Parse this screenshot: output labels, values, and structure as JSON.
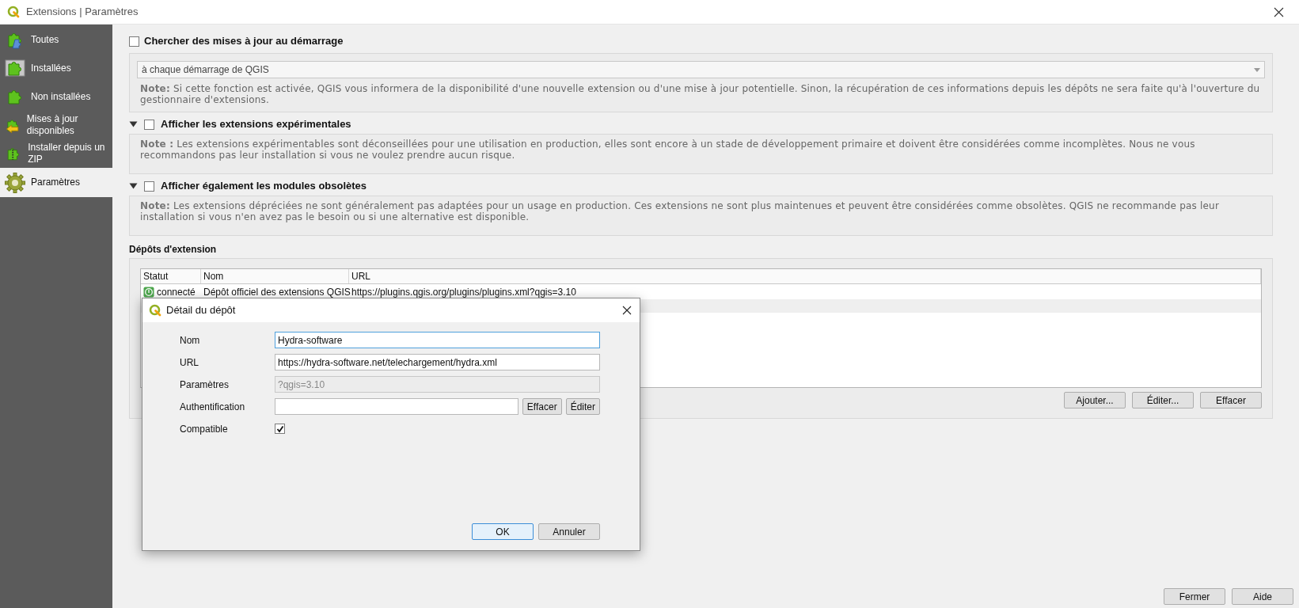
{
  "window": {
    "title": "Extensions | Paramètres"
  },
  "sidebar": {
    "items": [
      {
        "label": "Toutes",
        "selected": false
      },
      {
        "label": "Installées",
        "selected": false
      },
      {
        "label": "Non installées",
        "selected": false
      },
      {
        "label": "Mises à jour disponibles",
        "selected": false
      },
      {
        "label": "Installer depuis un ZIP",
        "selected": false
      },
      {
        "label": "Paramètres",
        "selected": true
      }
    ]
  },
  "check_updates": {
    "label": "Chercher des mises à jour au démarrage",
    "checked": false,
    "frequency": "à chaque démarrage de QGIS",
    "note": "**Note:** Si cette fonction est activée, QGIS vous informera de la disponibilité d'une nouvelle extension ou d'une mise à jour potentielle. Sinon, la récupération de ces informations depuis les dépôts ne sera faite qu'à l'ouverture du gestionnaire d'extensions."
  },
  "experimental": {
    "label": "Afficher les extensions expérimentales",
    "checked": false,
    "expanded": true,
    "note": "**Note :** Les extensions expérimentables sont déconseillées pour une utilisation en production, elles sont encore à un stade de développement primaire et doivent être considérées comme incomplètes. Nous ne vous recommandons pas leur installation si vous ne voulez prendre aucun risque."
  },
  "deprecated": {
    "label": "Afficher également les modules obsolètes",
    "checked": false,
    "expanded": true,
    "note": "**Note:** Les extensions dépréciées ne sont généralement pas adaptées pour un usage en production. Ces extensions ne sont plus maintenues et peuvent être considérées comme obsolètes. QGIS ne recommande pas leur installation si vous n'en avez pas le besoin ou si une alternative est disponible."
  },
  "repositories": {
    "title": "Dépôts d'extension",
    "columns": [
      "Statut",
      "Nom",
      "URL"
    ],
    "rows": [
      {
        "status": "connecté",
        "connected": true,
        "name": "Dépôt officiel des extensions QGIS",
        "url": "https://plugins.qgis.org/plugins/plugins.xml?qgis=3.10"
      }
    ],
    "buttons": [
      "Ajouter...",
      "Éditer...",
      "Effacer"
    ]
  },
  "footer_buttons": [
    "Fermer",
    "Aide"
  ],
  "dialog": {
    "title": "Détail du dépôt",
    "fields": [
      {
        "kind": "text",
        "label": "Nom",
        "value": "Hydra-software",
        "focused": true
      },
      {
        "kind": "text",
        "label": "URL",
        "value": "https://hydra-software.net/telechargement/hydra.xml",
        "focused": false
      },
      {
        "kind": "disabled",
        "label": "Paramètres",
        "value": "?qgis=3.10"
      },
      {
        "kind": "auth",
        "label": "Authentification",
        "buttons": [
          "Effacer",
          "Éditer"
        ]
      },
      {
        "kind": "checkbox",
        "label": "Compatible",
        "checked": true
      }
    ],
    "buttons": [
      {
        "label": "OK",
        "default": true
      },
      {
        "label": "Annuler",
        "default": false
      }
    ]
  }
}
